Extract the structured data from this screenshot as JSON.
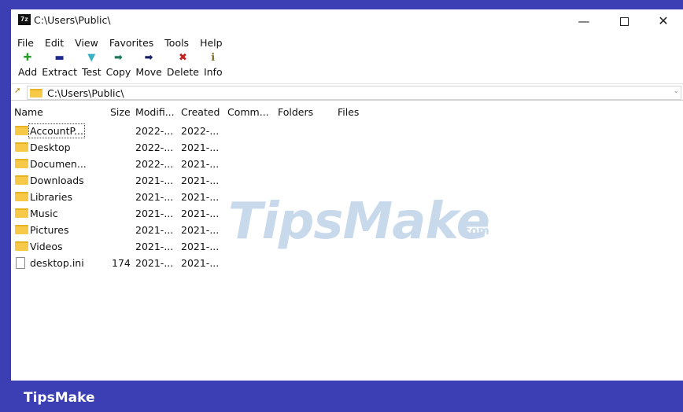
{
  "window": {
    "title": "C:\\Users\\Public\\",
    "icon_text": "7z",
    "min_symbol": "—",
    "close_symbol": "✕"
  },
  "menu": [
    "File",
    "Edit",
    "View",
    "Favorites",
    "Tools",
    "Help"
  ],
  "toolbar": [
    {
      "label": "Add",
      "icon": "plus-icon",
      "glyph": "✚",
      "color": "#2a9d2a"
    },
    {
      "label": "Extract",
      "icon": "minus-icon",
      "glyph": "▬",
      "color": "#1b2a8c"
    },
    {
      "label": "Test",
      "icon": "check-icon",
      "glyph": "▼",
      "color": "#3ab0c4"
    },
    {
      "label": "Copy",
      "icon": "arrow-right-icon",
      "glyph": "➡",
      "color": "#1e7a5a"
    },
    {
      "label": "Move",
      "icon": "arrow-right-icon",
      "glyph": "➡",
      "color": "#16206e"
    },
    {
      "label": "Delete",
      "icon": "delete-icon",
      "glyph": "✖",
      "color": "#c41f1f"
    },
    {
      "label": "Info",
      "icon": "info-icon",
      "glyph": "ℹ",
      "color": "#7a6a2a"
    }
  ],
  "address": {
    "path": "C:\\Users\\Public\\",
    "up_glyph": "➚",
    "drop_glyph": "⌄"
  },
  "columns": [
    "Name",
    "Size",
    "Modifi...",
    "Created",
    "Comm...",
    "Folders",
    "Files"
  ],
  "files": [
    {
      "name": "AccountP...",
      "size": "",
      "modified": "2022-...",
      "created": "2022-...",
      "type": "folder",
      "selected": true
    },
    {
      "name": "Desktop",
      "size": "",
      "modified": "2022-...",
      "created": "2021-...",
      "type": "folder"
    },
    {
      "name": "Documen...",
      "size": "",
      "modified": "2022-...",
      "created": "2021-...",
      "type": "folder"
    },
    {
      "name": "Downloads",
      "size": "",
      "modified": "2021-...",
      "created": "2021-...",
      "type": "folder"
    },
    {
      "name": "Libraries",
      "size": "",
      "modified": "2021-...",
      "created": "2021-...",
      "type": "folder"
    },
    {
      "name": "Music",
      "size": "",
      "modified": "2021-...",
      "created": "2021-...",
      "type": "folder"
    },
    {
      "name": "Pictures",
      "size": "",
      "modified": "2021-...",
      "created": "2021-...",
      "type": "folder"
    },
    {
      "name": "Videos",
      "size": "",
      "modified": "2021-...",
      "created": "2021-...",
      "type": "folder"
    },
    {
      "name": "desktop.ini",
      "size": "174",
      "modified": "2021-...",
      "created": "2021-...",
      "type": "file"
    }
  ],
  "watermark": {
    "main": "TipsMake",
    "sub": ".com"
  },
  "brand": "TipsMake",
  "colors": {
    "background": "#3b3fb3",
    "folder": "#f7c948",
    "watermark": "#c9d9ec"
  }
}
